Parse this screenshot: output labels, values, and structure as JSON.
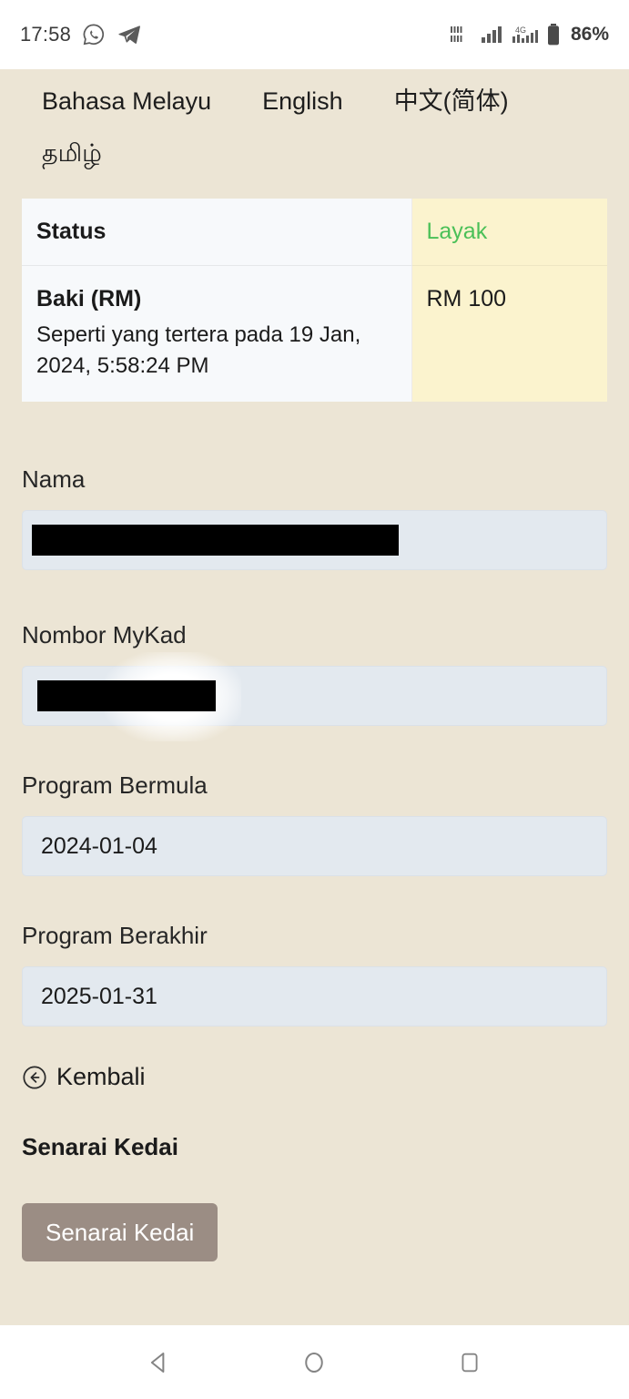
{
  "status_bar": {
    "time": "17:58",
    "icons": [
      "whatsapp-icon",
      "telegram-icon",
      "volte-icon",
      "signal-bars-icon",
      "network-4g-icon",
      "battery-icon"
    ],
    "network_label": "4G",
    "volte_label": "VoLTE",
    "battery_percent": "86%"
  },
  "languages": [
    {
      "label": "Bahasa Melayu"
    },
    {
      "label": "English"
    },
    {
      "label": "中文(简体)"
    },
    {
      "label": "தமிழ்"
    }
  ],
  "status_table": {
    "rows": [
      {
        "label": "Status",
        "sub": "",
        "value": "Layak",
        "value_color": "#4bc058"
      },
      {
        "label": "Baki (RM)",
        "sub": "Seperti yang tertera pada 19 Jan, 2024, 5:58:24 PM",
        "value": "RM 100",
        "value_color": "#1b1b1b"
      }
    ]
  },
  "form": {
    "fields": [
      {
        "label": "Nama",
        "value": "",
        "placeholder": ""
      },
      {
        "label": "Nombor MyKad",
        "value": "",
        "placeholder": ""
      },
      {
        "label": "Program Bermula",
        "value": "2024-01-04",
        "placeholder": ""
      },
      {
        "label": "Program Berakhir",
        "value": "2025-01-31",
        "placeholder": ""
      }
    ]
  },
  "back_link": {
    "label": "Kembali",
    "icon": "arrow-left-circle-icon"
  },
  "shops": {
    "section_title": "Senarai Kedai",
    "button_label": "Senarai Kedai"
  },
  "nav_bar": {
    "back": "back-triangle-icon",
    "home": "home-circle-icon",
    "recents": "recents-square-icon"
  },
  "colors": {
    "page_background": "#ece5d5",
    "table_label_cell": "#f7f9fb",
    "table_value_cell": "#fbf3ce",
    "status_green": "#4bc058",
    "input_background": "#e3e9ef",
    "button_background": "#9b8d84"
  }
}
